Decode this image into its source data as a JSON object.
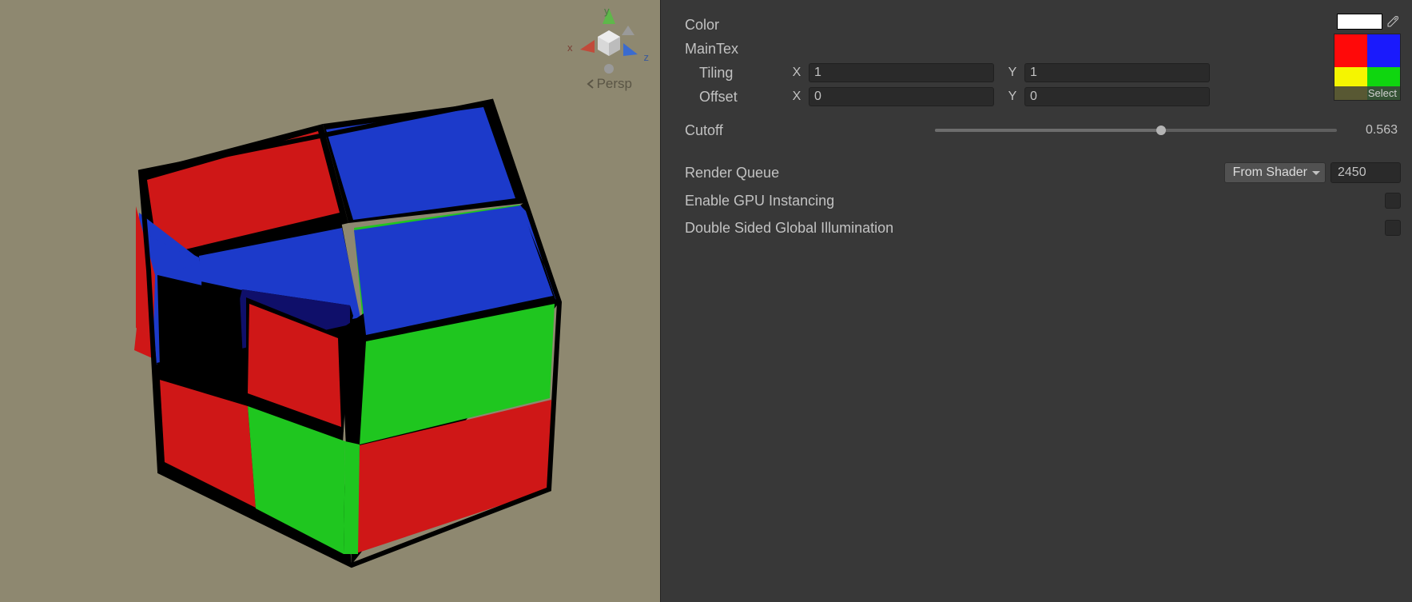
{
  "viewport": {
    "gizmo_axes": {
      "x": "x",
      "y": "y",
      "z": "z"
    },
    "projection_label": "Persp"
  },
  "inspector": {
    "color": {
      "label": "Color",
      "value_hex": "#ffffff"
    },
    "maintex": {
      "label": "MainTex",
      "tiling": {
        "label": "Tiling",
        "x_label": "X",
        "x_value": "1",
        "y_label": "Y",
        "y_value": "1"
      },
      "offset": {
        "label": "Offset",
        "x_label": "X",
        "x_value": "0",
        "y_label": "Y",
        "y_value": "0"
      },
      "preview_colors": [
        "#ff0909",
        "#1a1afc",
        "#f5f500",
        "#0fd60f"
      ],
      "select_label": "Select"
    },
    "cutoff": {
      "label": "Cutoff",
      "value": "0.563",
      "value_numeric": 0.563
    },
    "render_queue": {
      "label": "Render Queue",
      "dropdown_value": "From Shader",
      "value": "2450"
    },
    "gpu_instancing": {
      "label": "Enable GPU Instancing",
      "checked": false
    },
    "double_sided_gi": {
      "label": "Double Sided Global Illumination",
      "checked": false
    }
  }
}
